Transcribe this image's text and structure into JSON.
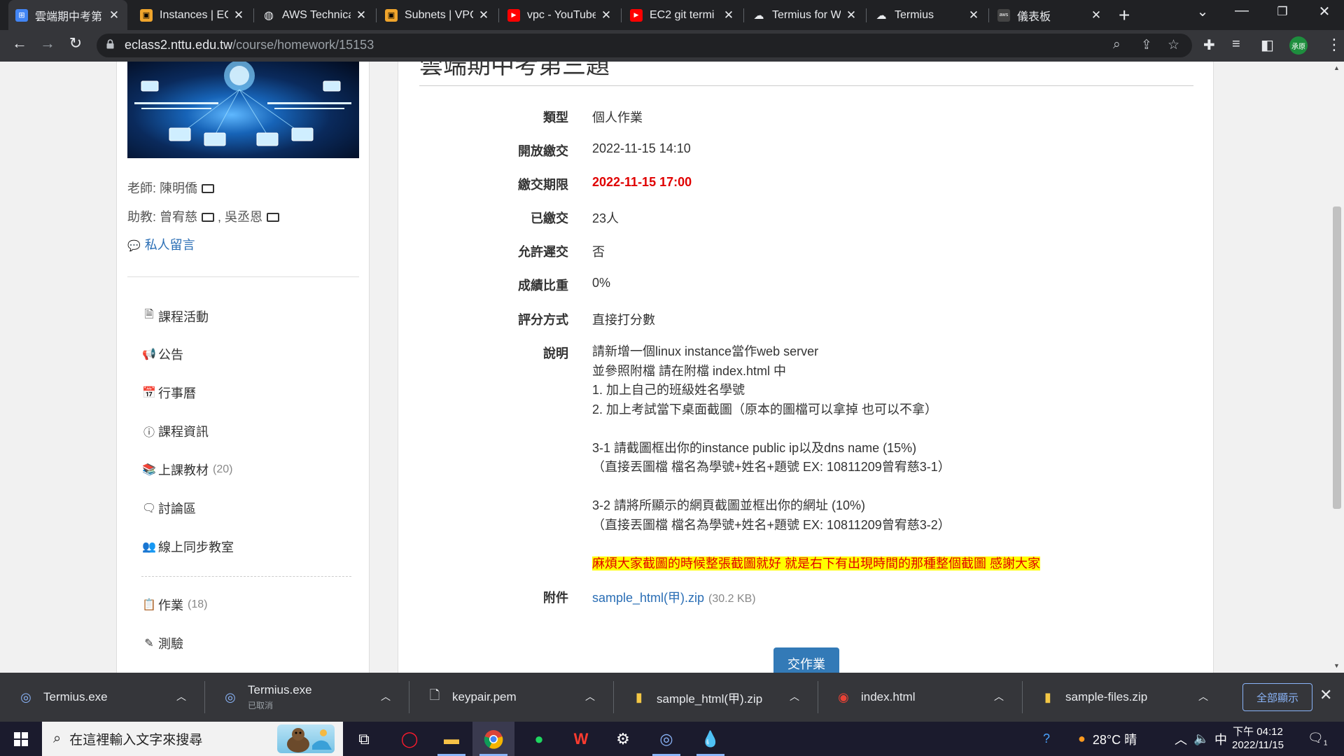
{
  "browser": {
    "tabs": [
      {
        "title": "雲端期中考第",
        "active": true
      },
      {
        "title": "Instances | EC"
      },
      {
        "title": "AWS Technica"
      },
      {
        "title": "Subnets | VPC"
      },
      {
        "title": "vpc - YouTube"
      },
      {
        "title": "EC2 git termi"
      },
      {
        "title": "Termius for W"
      },
      {
        "title": "Termius"
      },
      {
        "title": "儀表板"
      }
    ],
    "url_host": "eclass2.nttu.edu.tw",
    "url_path": "/course/homework/15153",
    "profile_label": "承原"
  },
  "sidebar": {
    "teacher_label": "老師: 陳明僑",
    "ta_label1": "助教: 曾宥慈",
    "ta_label2": ", 吳丞恩",
    "private_message": "私人留言",
    "items": [
      {
        "label": "課程活動",
        "icon": "activity-icon"
      },
      {
        "label": "公告",
        "icon": "megaphone-icon"
      },
      {
        "label": "行事曆",
        "icon": "calendar-icon"
      },
      {
        "label": "課程資訊",
        "icon": "info-icon"
      },
      {
        "label": "上課教材",
        "count": "(20)",
        "icon": "books-icon"
      },
      {
        "label": "討論區",
        "icon": "comment-icon"
      },
      {
        "label": "線上同步教室",
        "icon": "classroom-icon"
      },
      {
        "label": "作業",
        "count": "(18)",
        "icon": "clipboard-icon"
      },
      {
        "label": "測驗",
        "icon": "edit-icon"
      }
    ]
  },
  "homework": {
    "title": "雲端期中考第三題",
    "fields": {
      "type": {
        "label": "類型",
        "value": "個人作業"
      },
      "open": {
        "label": "開放繳交",
        "value": "2022-11-15 14:10"
      },
      "deadline": {
        "label": "繳交期限",
        "value": "2022-11-15 17:00"
      },
      "submitted": {
        "label": "已繳交",
        "value": "23人"
      },
      "late": {
        "label": "允許遲交",
        "value": "否"
      },
      "weight": {
        "label": "成績比重",
        "value": "0%"
      },
      "grading": {
        "label": "評分方式",
        "value": "直接打分數"
      }
    },
    "description_label": "說明",
    "description": {
      "line1": "請新增一個linux instance當作web server",
      "line2": "並參照附檔  請在附檔 index.html 中",
      "line3": "1. 加上自己的班級姓名學號",
      "line4": "2. 加上考試當下桌面截圖（原本的圖檔可以拿掉  也可以不拿）",
      "line5": "3-1  請截圖框出你的instance public ip以及dns name  (15%)",
      "line6": "（直接丟圖檔  檔名為學號+姓名+題號  EX: 10811209曾宥慈3-1）",
      "line7": "3-2  請將所顯示的網頁截圖並框出你的網址 (10%)",
      "line8": "（直接丟圖檔  檔名為學號+姓名+題號  EX: 10811209曾宥慈3-2）",
      "notice": "麻煩大家截圖的時候整張截圖就好  就是右下有出現時間的那種整個截圖  感謝大家"
    },
    "attachment_label": "附件",
    "attachment_name": "sample_html(甲).zip",
    "attachment_size": "(30.2 KB)",
    "submit_label": "交作業"
  },
  "downloads": {
    "items": [
      {
        "name": "Termius.exe",
        "sub": ""
      },
      {
        "name": "Termius.exe",
        "sub": "已取消"
      },
      {
        "name": "keypair.pem",
        "sub": ""
      },
      {
        "name": "sample_html(甲).zip",
        "sub": ""
      },
      {
        "name": "index.html",
        "sub": ""
      },
      {
        "name": "sample-files.zip",
        "sub": ""
      }
    ],
    "show_all": "全部顯示"
  },
  "taskbar": {
    "search_placeholder": "在這裡輸入文字來搜尋",
    "weather": "28°C 晴",
    "ime": "中",
    "time": "下午 04:12",
    "date": "2022/11/15",
    "notification_count": "1"
  },
  "colors": {
    "deadline": "#e00000",
    "link": "#2a6eb5",
    "submit_button": "#337ab7",
    "highlight": "#ffff00"
  }
}
